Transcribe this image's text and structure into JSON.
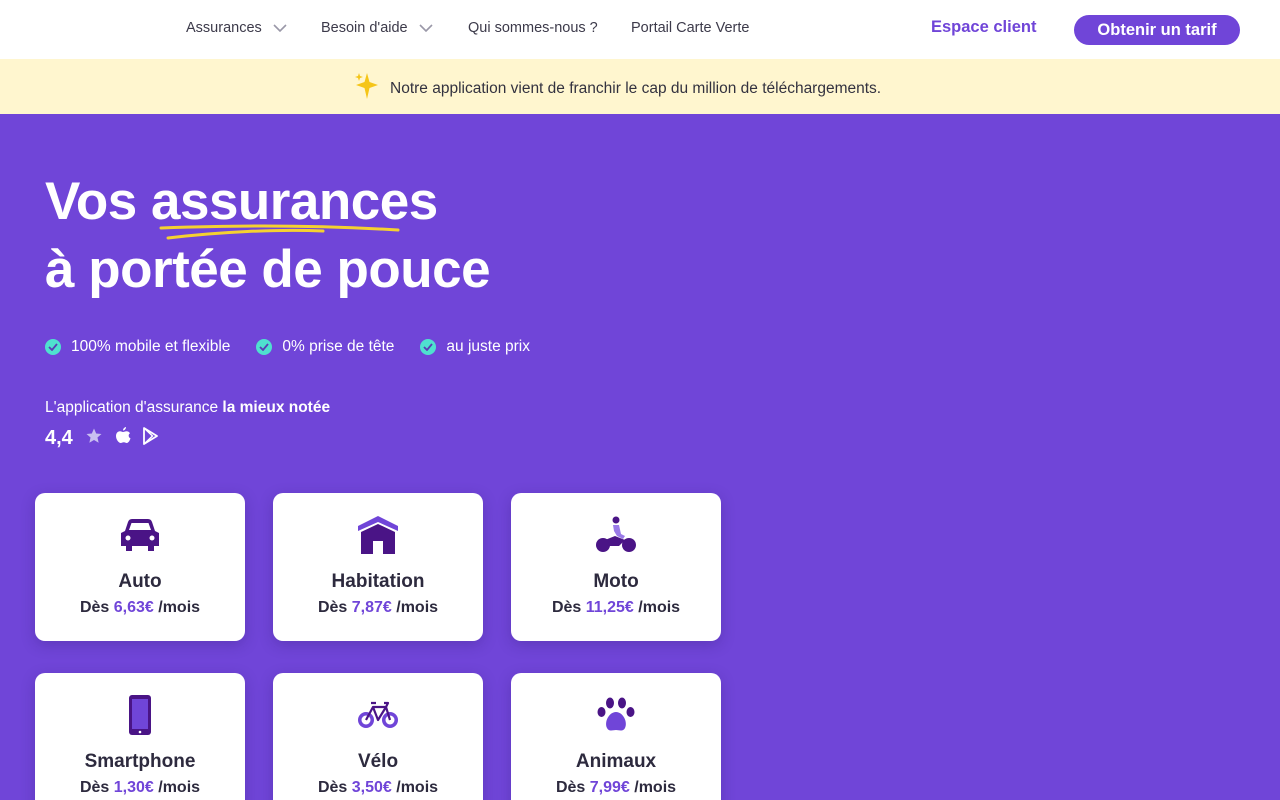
{
  "colors": {
    "brand": "#7045d8",
    "banner_bg": "#fff6cf",
    "check": "#4fe0cf",
    "icon_dark": "#4a1486"
  },
  "nav": {
    "items": [
      {
        "label": "Assurances",
        "has_dropdown": true
      },
      {
        "label": "Besoin d'aide",
        "has_dropdown": true
      },
      {
        "label": "Qui sommes-nous ?",
        "has_dropdown": false
      },
      {
        "label": "Portail Carte Verte",
        "has_dropdown": false
      }
    ],
    "espace_client": "Espace client",
    "cta": "Obtenir un tarif"
  },
  "banner": {
    "icon": "sparkles-icon",
    "text": "Notre application vient de franchir le cap du million de téléchargements."
  },
  "hero": {
    "title_line1_prefix": "Vos ",
    "title_line1_highlight": "assurances",
    "title_line2": "à portée de pouce",
    "features": [
      "100% mobile et flexible",
      "0% prise de tête",
      "au juste prix"
    ],
    "rating_text_prefix": "L'application d'assurance ",
    "rating_text_bold": "la mieux notée",
    "rating_value": "4,4"
  },
  "products": [
    {
      "name": "Auto",
      "prefix": "Dès",
      "price": "6,63€",
      "suffix": "/mois",
      "icon": "car-icon"
    },
    {
      "name": "Habitation",
      "prefix": "Dès",
      "price": "7,87€",
      "suffix": "/mois",
      "icon": "house-icon"
    },
    {
      "name": "Moto",
      "prefix": "Dès",
      "price": "11,25€",
      "suffix": "/mois",
      "icon": "motorbike-icon"
    },
    {
      "name": "Smartphone",
      "prefix": "Dès",
      "price": "1,30€",
      "suffix": "/mois",
      "icon": "smartphone-icon"
    },
    {
      "name": "Vélo",
      "prefix": "Dès",
      "price": "3,50€",
      "suffix": "/mois",
      "icon": "bicycle-icon"
    },
    {
      "name": "Animaux",
      "prefix": "Dès",
      "price": "7,99€",
      "suffix": "/mois",
      "icon": "paw-icon"
    }
  ]
}
